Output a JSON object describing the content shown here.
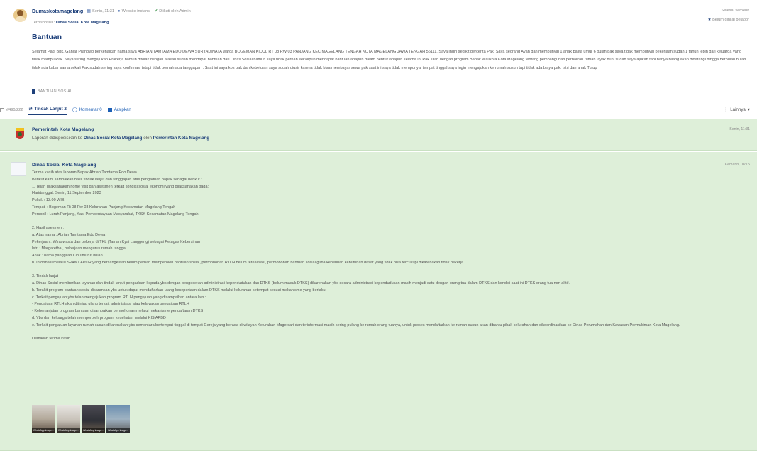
{
  "post": {
    "username": "Dumaskotamagelang",
    "date": "Senin, 11:31",
    "channel": "Website instansi",
    "verified": "Diikuti oleh Admin",
    "disposition_label": "Terdisposisi :",
    "disposition_target": "Dinas Sosial Kota Magelang",
    "status": "Selesai semenit",
    "rating": "Belum dinilai pelapor",
    "title": "Bantuan",
    "body": "Selamat Pagi Bpk. Ganjar Pranowo perkenalkan nama saya ABRIAN TAMTAMA EDO DEWA SURYADINATA warga BOGEMAN KIDUL RT 08 RW 03 PANJANG KEC.MAGELANG TENGAH KOTA MAGELANG JAWA TENGAH 56111. Saya ingin sedikit bercerita Pak, Saya seorang Ayah dan mempunyai 1 anak balita umur 6 bulan pak saya tidak mempunyai pekerjaan sudah 1 tahun lebih dari keluarga yang tidak mampu Pak. Saya sering mengajukan Prakerja namun ditolak dengan alasan sudah mendapat bantuan dari Dinas Sosial namun saya tidak pernah sekalipun mendapat bantuan apapun dalam bentuk apapun selama ini Pak. Dan dengan program Bapak Walikota Kota Magelang tentang pembangunan perbaikan rumah layak huni sudah saya ajukan tapi hanya bilang akan didatangi hingga berbulan bulan tidak ada kabar sama sekali Pak sudah sering saya konfirmasi tetapi tidak pernah ada tanggapan . Saat ini saya kos pak dan kebetulan saya sudah diusir karena tidak bisa membayar sewa pak saat ini saya tidak mempunyai tempat tinggal saya ingin mengajukan ke rumah susun tapi tidak ada biaya pak. Istri dan anak Tutup",
    "tag": "BANTUAN SOSIAL"
  },
  "toolbar": {
    "id": "#490/222",
    "followups": "Tindak Lanjut 2",
    "comments": "Komentar 0",
    "archive": "Arsipkan",
    "more": "Lainnya"
  },
  "followups": [
    {
      "author": "Pemerintah Kota Magelang",
      "time": "Senin, 11:31",
      "text_prefix": "Laporan didisposisikan ke",
      "target": "Dinas Sosial Kota Magelang",
      "text_mid": "oleh",
      "actor": "Pemerintah Kota Magelang"
    },
    {
      "author": "Dinas Sosial Kota Magelang",
      "time": "Kemarin, 08:15",
      "lines": [
        "Terima kasih atas laporan Bapak Abrian Tamtama Edo Dewa",
        "Berikut kami sampaikan hasil tindak lanjut dan tanggapan atas pengaduan bapak sebagai berikut :",
        "1. Telah dilaksanakan home visit dan asesmen terkait kondisi sosial ekonomi yang dilaksanakan pada:",
        "Hari/tanggal: Senin, 11 September 2023",
        "Pukul. : 13.00 WIB",
        "Tempat. : Bogeman Rt 08 Rw 03 Kelurahan Panjang Kecamatan Magelang Tengah",
        "Personil : Lurah Panjang, Kasi Pemberdayaan Masyarakat, TKSK Kecamatan Magelang Tengah",
        "",
        "2. Hasil asesmen :",
        "a. Atas nama : Abrian Tamtama Edo Dewa",
        "Pekerjaan : Wiraswasta dan bekerja di TKL (Taman Kyai Langgeng) sebagai Petugas Kebersihan",
        "Istri : Margaretha , pekerjaan mengurus rumah tangga",
        "Anak : nama panggilan Cio umur 6 bulan",
        "b. Informasi melalui SP4N LAPOR yang bersangkutan belum pernah memperoleh bantuan sosial, permohonan RTLH belum terealisasi, permohonan bantuan sosial guna keperluan kebutuhan dasar yang tidak bisa tercukupi dikarenakan tidak bekerja.",
        "",
        "3. Tindak lanjut :",
        "a. Dinas Sosial memberikan layanan dan tindak lanjut pengaduan kepada ybs dengan pengecekan administrasi kependudukan dan DTKS (belum masuk DTKS) dikarenakan ybs secara administrasi kependudukan masih menjadi satu dengan orang tua dalam DTKS dan kondisi saat ini DTKS orang tua non aktif.",
        "b. Terakit program bantuan sosial disarankan ybs untuk dapat mendaftarkan ulang kesepertaan dalam DTKS melalui kelurahan setempat sesuai mekanisme yang berlaku.",
        "c. Terkait pengajuan ybs telah mengajukan program RTLH pengajuan yang disampaikan antara lain :",
        "- Pengajuan RTLH akan ditinjau ulang terkait administrasi atau kelayakan pengajuan RTLH",
        "- Keberlanjutan program bantuan disampaikan permohonan melalui mekanisme pendaftaran DTKS",
        "d. Ybs dan keluarga telah memperoleh program kesehatan melalui KIS APBD",
        "e. Terkait pengajuan layanan rumah susun dikarenakan ybs sementara bertempat tinggal di tempat Gereja yang berada di wilayah Kelurahan Magersari dan terinformasi masih sering pulang ke rumah orang tuanya, untuk proses mendaftarkan ke rumah susun akan dibantu pihak kelurahan dan dikoordinasikan ke Dinas Perumahan dan Kawasan Permukiman Kota Magelang.",
        "",
        "Demikian terima kasih"
      ],
      "attachments": [
        "WhatsApp Image...",
        "WhatsApp Image...",
        "WhatsApp Image...",
        "WhatsApp Image..."
      ]
    }
  ],
  "colors": {
    "brand": "#1d3f7a",
    "followup_bg": "#deefd9"
  }
}
